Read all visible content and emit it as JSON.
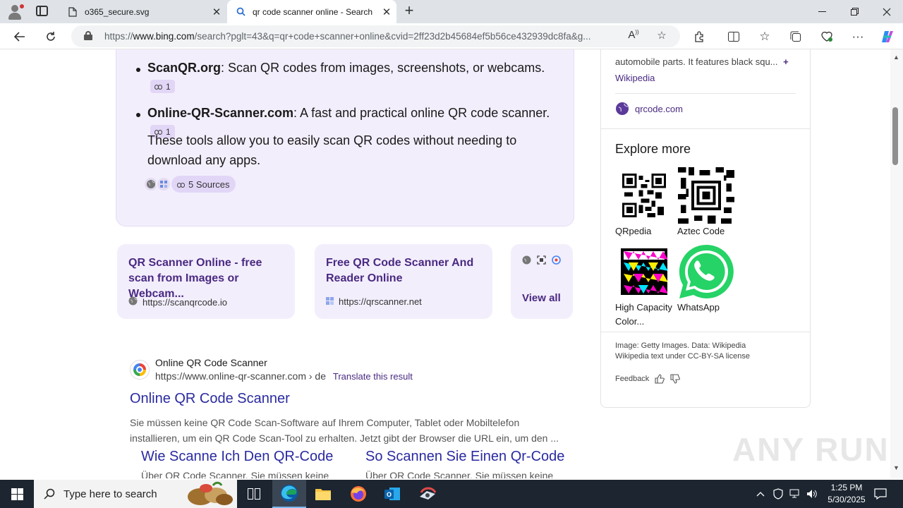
{
  "browser": {
    "tabs": [
      {
        "title": "o365_secure.svg",
        "icon": "file-icon",
        "active": false
      },
      {
        "title": "qr code scanner online - Search",
        "icon": "search-icon",
        "active": true
      }
    ],
    "url_prefix": "https://",
    "url_domain": "www.bing.com",
    "url_rest": "/search?pglt=43&q=qr+code+scanner+online&cvid=2ff23d2b45684ef5b56ce432939dc8fa&g..."
  },
  "ai_answer": {
    "items": [
      {
        "site": "ScanQR.org",
        "text": ": Scan QR codes from images, screenshots, or webcams.",
        "cite": "1"
      },
      {
        "site": "Online-QR-Scanner.com",
        "text": ": A fast and practical online QR code scanner.",
        "cite": "1"
      }
    ],
    "paragraph": "These tools allow you to easily scan QR codes without needing to download any apps.",
    "sources_label": "5 Sources"
  },
  "source_cards": [
    {
      "title": "QR Scanner Online - free scan from Images or Webcam...",
      "url": "https://scanqrcode.io"
    },
    {
      "title": "Free QR Code Scanner And Reader Online",
      "url": "https://qrscanner.net"
    }
  ],
  "view_all": "View all",
  "result": {
    "site_name": "Online QR Code Scanner",
    "site_url": "https://www.online-qr-scanner.com › de",
    "translate": "Translate this result",
    "title": "Online QR Code Scanner",
    "snippet": "Sie müssen keine QR Code Scan-Software auf Ihrem Computer, Tablet oder Mobiltelefon installieren, um ein QR Code Scan-Tool zu erhalten. Jetzt gibt der Browser die URL ein, um den ...",
    "deeplinks": [
      {
        "title": "Wie Scanne Ich Den QR-Code",
        "snippet": "Über QR Code Scanner. Sie müssen keine"
      },
      {
        "title": "So Scannen Sie Einen Qr-Code",
        "snippet": "Über QR Code Scanner. Sie müssen keine"
      }
    ]
  },
  "right_panel": {
    "desc_line": "automobile parts. It features black squ...",
    "more": "+",
    "wiki_link": "Wikipedia",
    "site_link": "qrcode.com",
    "explore_title": "Explore more",
    "explore": [
      {
        "label": "QRpedia"
      },
      {
        "label": "Aztec Code"
      },
      {
        "label": "High Capacity Color..."
      },
      {
        "label": "WhatsApp"
      }
    ],
    "credit1": "Image: Getty Images. Data: Wikipedia",
    "credit2": "Wikipedia text under CC-BY-SA license",
    "feedback": "Feedback"
  },
  "watermark": "ANY RUN",
  "taskbar": {
    "search_placeholder": "Type here to search",
    "time": "1:25 PM",
    "date": "5/30/2025"
  },
  "colors": {
    "accent": "#4a2a82",
    "card_bg": "#f3eefc",
    "link_blue": "#2a2aa0",
    "taskbar": "#1c2530"
  }
}
